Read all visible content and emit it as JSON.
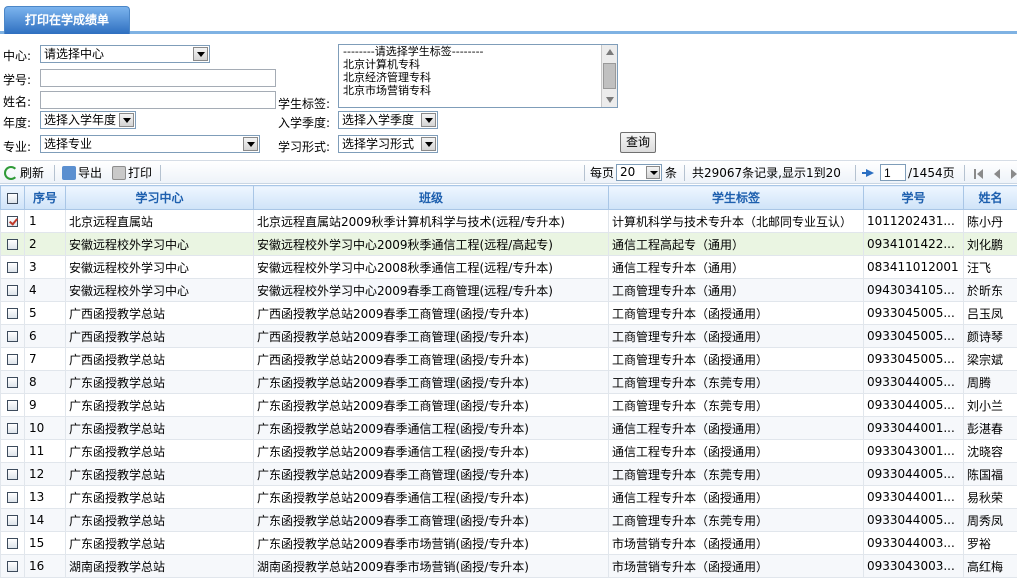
{
  "tab": {
    "title": "打印在学成绩单"
  },
  "form": {
    "center": {
      "label": "中心:",
      "value": "请选择中心"
    },
    "student_id": {
      "label": "学号:",
      "value": ""
    },
    "name": {
      "label": "姓名:",
      "value": ""
    },
    "year": {
      "label": "年度:",
      "value": "选择入学年度"
    },
    "major": {
      "label": "专业:",
      "value": "选择专业"
    },
    "tag": {
      "label": "学生标签:",
      "options": [
        "--------请选择学生标签--------",
        "北京计算机专科",
        "北京经济管理专科",
        "北京市场营销专科"
      ]
    },
    "season": {
      "label": "入学季度:",
      "value": "选择入学季度"
    },
    "study_mode": {
      "label": "学习形式:",
      "value": "选择学习形式"
    },
    "query_button": "查询"
  },
  "toolbar": {
    "refresh": "刷新",
    "export": "导出",
    "print": "打印",
    "per_page_label": "每页",
    "per_page_value": "20",
    "per_page_unit": "条",
    "summary": "共29067条记录,显示1到20",
    "page_input": "1",
    "page_total": "/1454页"
  },
  "grid": {
    "columns": [
      "序号",
      "学习中心",
      "班级",
      "学生标签",
      "学号",
      "姓名"
    ],
    "rows": [
      {
        "checked": true,
        "no": "1",
        "center": "北京远程直属站",
        "class": "北京远程直属站2009秋季计算机科学与技术(远程/专升本)",
        "tag": "计算机科学与技术专升本（北邮同专业互认）",
        "id": "1011202431...",
        "name": "陈小丹"
      },
      {
        "checked": false,
        "no": "2",
        "center": "安徽远程校外学习中心",
        "class": "安徽远程校外学习中心2009秋季通信工程(远程/高起专)",
        "tag": "通信工程高起专（通用）",
        "id": "0934101422...",
        "name": "刘化鹏"
      },
      {
        "checked": false,
        "no": "3",
        "center": "安徽远程校外学习中心",
        "class": "安徽远程校外学习中心2008秋季通信工程(远程/专升本)",
        "tag": "通信工程专升本（通用）",
        "id": "083411012001",
        "name": "汪飞"
      },
      {
        "checked": false,
        "no": "4",
        "center": "安徽远程校外学习中心",
        "class": "安徽远程校外学习中心2009春季工商管理(远程/专升本)",
        "tag": "工商管理专升本（通用）",
        "id": "0943034105...",
        "name": "於昕东"
      },
      {
        "checked": false,
        "no": "5",
        "center": "广西函授教学总站",
        "class": "广西函授教学总站2009春季工商管理(函授/专升本)",
        "tag": "工商管理专升本（函授通用）",
        "id": "0933045005...",
        "name": "吕玉凤"
      },
      {
        "checked": false,
        "no": "6",
        "center": "广西函授教学总站",
        "class": "广西函授教学总站2009春季工商管理(函授/专升本)",
        "tag": "工商管理专升本（函授通用）",
        "id": "0933045005...",
        "name": "颜诗琴"
      },
      {
        "checked": false,
        "no": "7",
        "center": "广西函授教学总站",
        "class": "广西函授教学总站2009春季工商管理(函授/专升本)",
        "tag": "工商管理专升本（函授通用）",
        "id": "0933045005...",
        "name": "梁宗斌"
      },
      {
        "checked": false,
        "no": "8",
        "center": "广东函授教学总站",
        "class": "广东函授教学总站2009春季工商管理(函授/专升本)",
        "tag": "工商管理专升本（东莞专用）",
        "id": "0933044005...",
        "name": "周腾"
      },
      {
        "checked": false,
        "no": "9",
        "center": "广东函授教学总站",
        "class": "广东函授教学总站2009春季工商管理(函授/专升本)",
        "tag": "工商管理专升本（东莞专用）",
        "id": "0933044005...",
        "name": "刘小兰"
      },
      {
        "checked": false,
        "no": "10",
        "center": "广东函授教学总站",
        "class": "广东函授教学总站2009春季通信工程(函授/专升本)",
        "tag": "通信工程专升本（函授通用）",
        "id": "0933044001...",
        "name": "彭湛春"
      },
      {
        "checked": false,
        "no": "11",
        "center": "广东函授教学总站",
        "class": "广东函授教学总站2009春季通信工程(函授/专升本)",
        "tag": "通信工程专升本（函授通用）",
        "id": "0933043001...",
        "name": "沈晓容"
      },
      {
        "checked": false,
        "no": "12",
        "center": "广东函授教学总站",
        "class": "广东函授教学总站2009春季工商管理(函授/专升本)",
        "tag": "工商管理专升本（东莞专用）",
        "id": "0933044005...",
        "name": "陈国福"
      },
      {
        "checked": false,
        "no": "13",
        "center": "广东函授教学总站",
        "class": "广东函授教学总站2009春季通信工程(函授/专升本)",
        "tag": "通信工程专升本（函授通用）",
        "id": "0933044001...",
        "name": "易秋荣"
      },
      {
        "checked": false,
        "no": "14",
        "center": "广东函授教学总站",
        "class": "广东函授教学总站2009春季工商管理(函授/专升本)",
        "tag": "工商管理专升本（东莞专用）",
        "id": "0933044005...",
        "name": "周秀凤"
      },
      {
        "checked": false,
        "no": "15",
        "center": "广东函授教学总站",
        "class": "广东函授教学总站2009春季市场营销(函授/专升本)",
        "tag": "市场营销专升本（函授通用）",
        "id": "0933044003...",
        "name": "罗裕"
      },
      {
        "checked": false,
        "no": "16",
        "center": "湖南函授教学总站",
        "class": "湖南函授教学总站2009春季市场营销(函授/专升本)",
        "tag": "市场营销专升本（函授通用）",
        "id": "0933043003...",
        "name": "高红梅"
      }
    ]
  }
}
